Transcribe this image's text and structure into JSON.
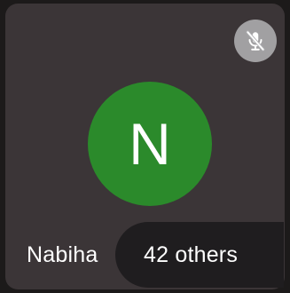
{
  "tile": {
    "participant_name": "Nabiha",
    "avatar_initial": "N",
    "avatar_color": "#2b8a2b",
    "mic_status_icon": "mic-off-icon",
    "others_label": "42 others"
  }
}
